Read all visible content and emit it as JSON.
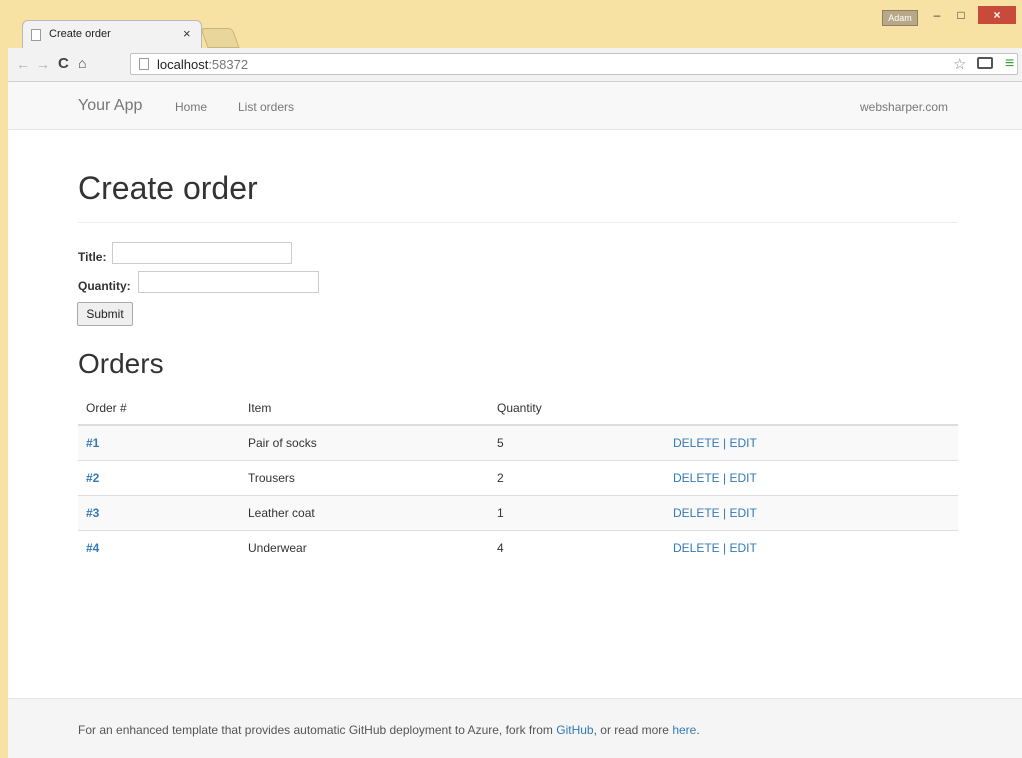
{
  "browser": {
    "tab_title": "Create order",
    "tab_close": "×",
    "user_badge": "Adam",
    "url_host": "localhost",
    "url_port": ":58372",
    "icons": {
      "back": "back-arrow-icon",
      "forward": "forward-arrow-icon",
      "reload": "reload-icon",
      "home": "home-icon",
      "star": "bookmark-star-icon",
      "cast": "cast-icon",
      "menu": "hamburger-menu-icon"
    }
  },
  "navbar": {
    "brand": "Your App",
    "links": [
      "Home",
      "List orders"
    ],
    "right": "websharper.com"
  },
  "form": {
    "heading": "Create order",
    "title_label": "Title:",
    "quantity_label": "Quantity:",
    "title_value": "",
    "quantity_value": "",
    "submit_label": "Submit"
  },
  "orders": {
    "heading": "Orders",
    "columns": [
      "Order #",
      "Item",
      "Quantity"
    ],
    "rows": [
      {
        "num": "#1",
        "item": "Pair of socks",
        "qty": "5",
        "delete": "DELETE",
        "sep": "|",
        "edit": "EDIT"
      },
      {
        "num": "#2",
        "item": "Trousers",
        "qty": "2",
        "delete": "DELETE",
        "sep": "|",
        "edit": "EDIT"
      },
      {
        "num": "#3",
        "item": "Leather coat",
        "qty": "1",
        "delete": "DELETE",
        "sep": "|",
        "edit": "EDIT"
      },
      {
        "num": "#4",
        "item": "Underwear",
        "qty": "4",
        "delete": "DELETE",
        "sep": "|",
        "edit": "EDIT"
      }
    ]
  },
  "footer": {
    "text_before": "For an enhanced template that provides automatic GitHub deployment to Azure, fork from ",
    "github_link": "GitHub",
    "text_middle": ", or read more ",
    "here_link": "here",
    "text_after": "."
  },
  "colors": {
    "link": "#337ab7",
    "window_frame": "#f7e2a3",
    "close_button": "#c84a3a"
  }
}
